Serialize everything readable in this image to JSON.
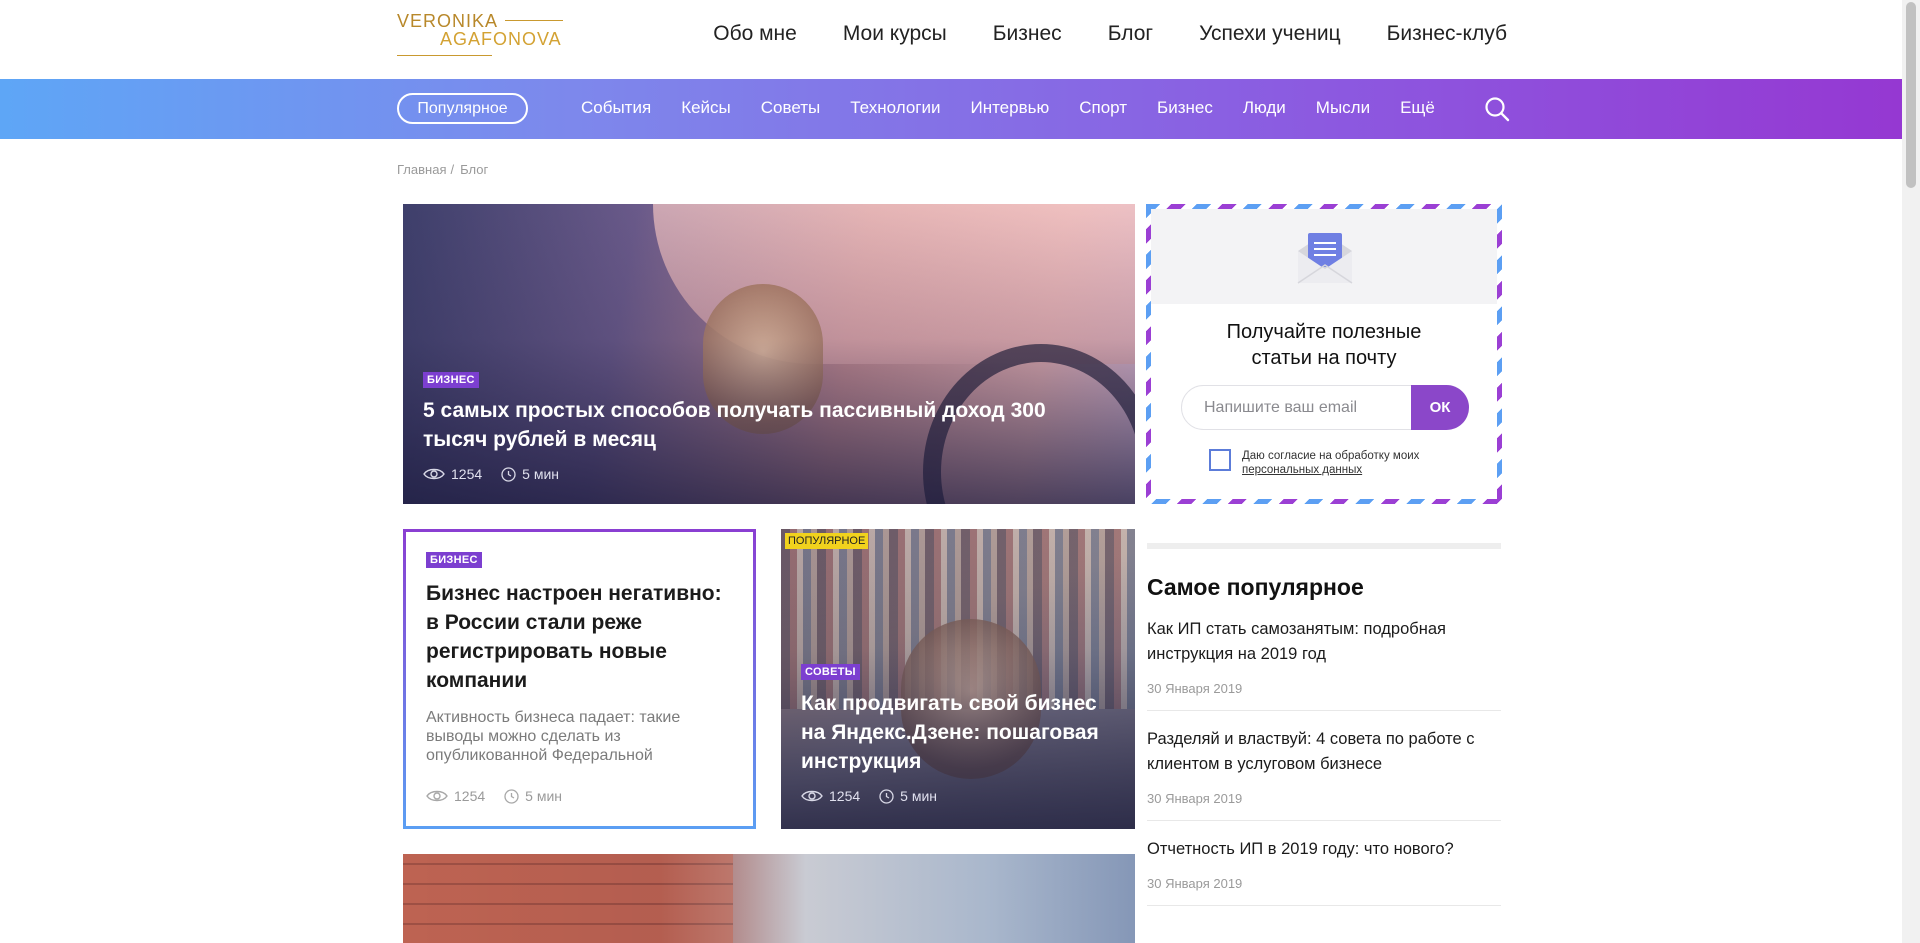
{
  "logo": {
    "line1": "VERONIKA",
    "line2": "AGAFONOVA"
  },
  "main_nav": [
    "Обо мне",
    "Мои курсы",
    "Бизнес",
    "Блог",
    "Успехи учениц",
    "Бизнес-клуб"
  ],
  "category_nav": {
    "active": "Популярное",
    "items": [
      "События",
      "Кейсы",
      "Советы",
      "Технологии",
      "Интервью",
      "Спорт",
      "Бизнес",
      "Люди",
      "Мысли",
      "Ещё"
    ]
  },
  "breadcrumb": {
    "home": "Главная",
    "separator": "/",
    "current": "Блог"
  },
  "hero": {
    "tag": "БИЗНЕС",
    "title": "5 самых простых способов получать пассивный доход 300 тысяч рублей в месяц",
    "views": "1254",
    "read_time": "5 мин"
  },
  "subscribe": {
    "heading_line1": "Получайте полезные",
    "heading_line2": "статьи на почту",
    "email_placeholder": "Напишите ваш email",
    "button": "ОК",
    "consent_text": "Даю согласие на обработку моих",
    "consent_link": "персональных данных"
  },
  "card1": {
    "tag": "БИЗНЕС",
    "title": "Бизнес настроен негативно: в России стали реже регистрировать новые компании",
    "lead": "Активность бизнеса падает: такие выводы можно сделать из опубликованной Федеральной",
    "views": "1254",
    "read_time": "5 мин"
  },
  "card2": {
    "badge": "ПОПУЛЯРНОЕ",
    "tag": "СОВЕТЫ",
    "title": "Как продвигать свой бизнес на Яндекс.Дзене: пошаговая инструкция",
    "views": "1254",
    "read_time": "5 мин"
  },
  "popular": {
    "heading": "Самое популярное",
    "items": [
      {
        "title": "Как ИП стать самозанятым: подробная инструкция на 2019 год",
        "date": "30 Января 2019"
      },
      {
        "title": "Разделяй и властвуй: 4 совета по работе с клиентом в услуговом бизнесе",
        "date": "30 Января 2019"
      },
      {
        "title": "Отчетность ИП в 2019 году: что нового?",
        "date": "30 Января 2019"
      }
    ]
  },
  "colors": {
    "accent": "#8b47c9",
    "gradient_start": "#5ea6f6",
    "gradient_end": "#9538d2",
    "popular_badge": "#f1d21d"
  }
}
